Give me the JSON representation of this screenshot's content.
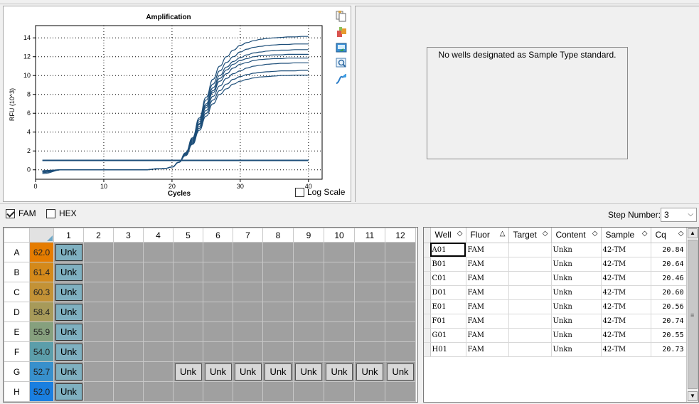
{
  "chart": {
    "title": "Amplification",
    "xlabel": "Cycles",
    "ylabel": "RFU (10^3)",
    "log_scale_label": "Log Scale",
    "log_scale_checked": false
  },
  "chart_data": {
    "type": "line",
    "title": "Amplification",
    "xlabel": "Cycles",
    "ylabel": "RFU (10^3)",
    "xlim": [
      0,
      42
    ],
    "ylim": [
      -1,
      15.3
    ],
    "xticks": [
      0,
      10,
      20,
      30,
      40
    ],
    "yticks": [
      0,
      2,
      4,
      6,
      8,
      10,
      12,
      14
    ],
    "grid": true,
    "threshold": 1.0,
    "series_color": "#1d4e79",
    "threshold_color": "#1d4e79",
    "x": [
      1,
      4,
      8,
      12,
      16,
      18,
      19,
      20,
      21,
      22,
      23,
      24,
      25,
      26,
      27,
      28,
      29,
      30,
      31,
      32,
      33,
      34,
      35,
      36,
      37,
      38,
      39,
      40
    ],
    "series": [
      {
        "values": [
          -0.1,
          0.0,
          0.0,
          0.0,
          0.0,
          0.1,
          0.15,
          0.3,
          0.8,
          1.8,
          3.4,
          5.5,
          7.7,
          9.6,
          11.0,
          12.0,
          12.7,
          13.2,
          13.5,
          13.7,
          13.85,
          13.95,
          14.0,
          14.05,
          14.1,
          14.1,
          14.15,
          14.15
        ]
      },
      {
        "values": [
          -0.1,
          0.0,
          0.0,
          0.0,
          0.0,
          0.1,
          0.15,
          0.3,
          0.8,
          1.8,
          3.3,
          5.3,
          7.4,
          9.1,
          10.5,
          11.4,
          12.0,
          12.5,
          12.8,
          13.0,
          13.1,
          13.2,
          13.25,
          13.3,
          13.3,
          13.35,
          13.35,
          13.35
        ]
      },
      {
        "values": [
          -0.1,
          0.0,
          0.0,
          0.0,
          0.0,
          0.1,
          0.15,
          0.3,
          0.8,
          1.7,
          3.2,
          5.1,
          7.0,
          8.7,
          10.0,
          10.9,
          11.5,
          11.9,
          12.2,
          12.4,
          12.5,
          12.6,
          12.65,
          12.7,
          12.7,
          12.75,
          12.75,
          12.75
        ]
      },
      {
        "values": [
          -0.2,
          0.0,
          0.0,
          0.0,
          0.0,
          0.1,
          0.15,
          0.3,
          0.8,
          1.7,
          3.1,
          4.9,
          6.8,
          8.4,
          9.7,
          10.6,
          11.2,
          11.6,
          11.8,
          12.0,
          12.1,
          12.15,
          12.2,
          12.2,
          12.25,
          12.25,
          12.25,
          12.25
        ]
      },
      {
        "values": [
          -0.2,
          0.0,
          0.0,
          0.0,
          0.0,
          0.1,
          0.15,
          0.3,
          0.8,
          1.7,
          3.0,
          4.8,
          6.6,
          8.2,
          9.4,
          10.2,
          10.8,
          11.2,
          11.4,
          11.6,
          11.7,
          11.75,
          11.8,
          11.8,
          11.85,
          11.85,
          11.85,
          11.85
        ]
      },
      {
        "values": [
          -0.2,
          0.0,
          0.0,
          0.0,
          0.0,
          0.1,
          0.15,
          0.3,
          0.8,
          1.6,
          2.9,
          4.6,
          6.3,
          7.8,
          8.9,
          9.7,
          10.2,
          10.5,
          10.8,
          11.0,
          11.1,
          11.2,
          11.25,
          11.3,
          11.3,
          11.35,
          11.35,
          11.35
        ]
      },
      {
        "values": [
          -0.3,
          0.0,
          0.0,
          0.0,
          0.0,
          0.1,
          0.15,
          0.3,
          0.8,
          1.6,
          2.8,
          4.4,
          6.0,
          7.4,
          8.4,
          9.1,
          9.6,
          9.9,
          10.1,
          10.25,
          10.35,
          10.4,
          10.45,
          10.5,
          10.5,
          10.5,
          10.55,
          10.55
        ]
      },
      {
        "values": [
          -0.4,
          0.0,
          0.0,
          0.0,
          0.0,
          0.1,
          0.15,
          0.3,
          0.8,
          1.5,
          2.7,
          4.2,
          5.7,
          7.0,
          8.0,
          8.6,
          9.1,
          9.4,
          9.6,
          9.75,
          9.85,
          9.9,
          9.95,
          10.0,
          10.0,
          10.05,
          10.05,
          10.05
        ]
      }
    ]
  },
  "std_curve": {
    "message": "No wells designated as Sample Type standard."
  },
  "fluors": [
    {
      "label": "FAM",
      "checked": true
    },
    {
      "label": "HEX",
      "checked": false
    }
  ],
  "step": {
    "label": "Step Number:",
    "value": "3"
  },
  "plate": {
    "columns": [
      "1",
      "2",
      "3",
      "4",
      "5",
      "6",
      "7",
      "8",
      "9",
      "10",
      "11",
      "12"
    ],
    "rows": [
      {
        "letter": "A",
        "temp": "62.0",
        "color": "#e57c00"
      },
      {
        "letter": "B",
        "temp": "61.4",
        "color": "#d4891a"
      },
      {
        "letter": "C",
        "temp": "60.3",
        "color": "#c39236"
      },
      {
        "letter": "D",
        "temp": "58.4",
        "color": "#a79a5a"
      },
      {
        "letter": "E",
        "temp": "55.9",
        "color": "#86a07e"
      },
      {
        "letter": "F",
        "temp": "54.0",
        "color": "#5c9eaa"
      },
      {
        "letter": "G",
        "temp": "52.7",
        "color": "#3890cc"
      },
      {
        "letter": "H",
        "temp": "52.0",
        "color": "#1a7fe0"
      }
    ],
    "unk_label": "Unk"
  },
  "well_table": {
    "headers": [
      "Well",
      "Fluor",
      "Target",
      "Content",
      "Sample",
      "Cq"
    ],
    "rows": [
      [
        "A01",
        "FAM",
        "",
        "Unkn",
        "42-TM",
        "20.84"
      ],
      [
        "B01",
        "FAM",
        "",
        "Unkn",
        "42-TM",
        "20.64"
      ],
      [
        "C01",
        "FAM",
        "",
        "Unkn",
        "42-TM",
        "20.46"
      ],
      [
        "D01",
        "FAM",
        "",
        "Unkn",
        "42-TM",
        "20.60"
      ],
      [
        "E01",
        "FAM",
        "",
        "Unkn",
        "42-TM",
        "20.56"
      ],
      [
        "F01",
        "FAM",
        "",
        "Unkn",
        "42-TM",
        "20.74"
      ],
      [
        "G01",
        "FAM",
        "",
        "Unkn",
        "42-TM",
        "20.55"
      ],
      [
        "H01",
        "FAM",
        "",
        "Unkn",
        "42-TM",
        "20.73"
      ]
    ]
  },
  "tool_icons": [
    "copy-icon",
    "export-icon",
    "save-image-icon",
    "zoom-icon",
    "curve-settings-icon"
  ]
}
